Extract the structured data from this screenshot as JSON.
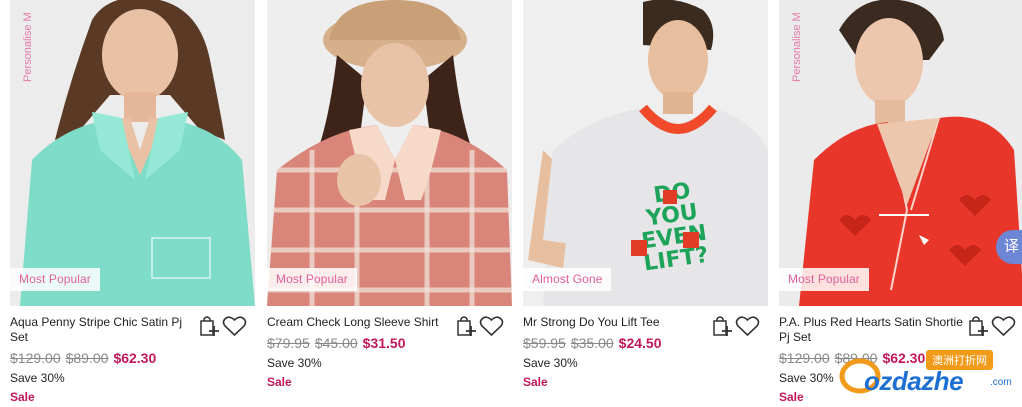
{
  "vertical_label": "Personalise M",
  "products": [
    {
      "badge": "Most Popular",
      "name": "Aqua Penny Stripe Chic Satin Pj Set",
      "was_price_1": "$129.00",
      "was_price_2": "$89.00",
      "now_price": "$62.30",
      "save": "Save 30%",
      "sale": "Sale",
      "garment_color": "#7fdcc8"
    },
    {
      "badge": "Most Popular",
      "name": "Cream Check Long Sleeve Shirt",
      "was_price_1": "$79.95",
      "was_price_2": "$45.00",
      "now_price": "$31.50",
      "save": "Save 30%",
      "sale": "Sale",
      "garment_color": "#d9857a"
    },
    {
      "badge": "Almost Gone",
      "name": "Mr Strong Do You Lift Tee",
      "was_price_1": "$59.95",
      "was_price_2": "$35.00",
      "now_price": "$24.50",
      "save": "Save 30%",
      "sale": "Sale",
      "garment_color": "#e6e6e8",
      "print_text": [
        "DO",
        "YOU",
        "EVEN",
        "LIFT?"
      ]
    },
    {
      "badge": "Most Popular",
      "name": "P.A. Plus Red Hearts Satin Shortie Pj Set",
      "was_price_1": "$129.00",
      "was_price_2": "$89.00",
      "now_price": "$62.30",
      "save": "Save 30%",
      "sale": "Sale",
      "garment_color": "#e8362a"
    }
  ],
  "translate_tab": "译",
  "watermark": {
    "text": "ozdazhe",
    "suffix": ".com",
    "cn": "澳洲打折网"
  },
  "colors": {
    "badge_text": "#e0609a",
    "sale": "#c2185b",
    "strike": "#888888"
  },
  "icons": [
    "add-to-bag-icon",
    "wishlist-heart-icon"
  ]
}
